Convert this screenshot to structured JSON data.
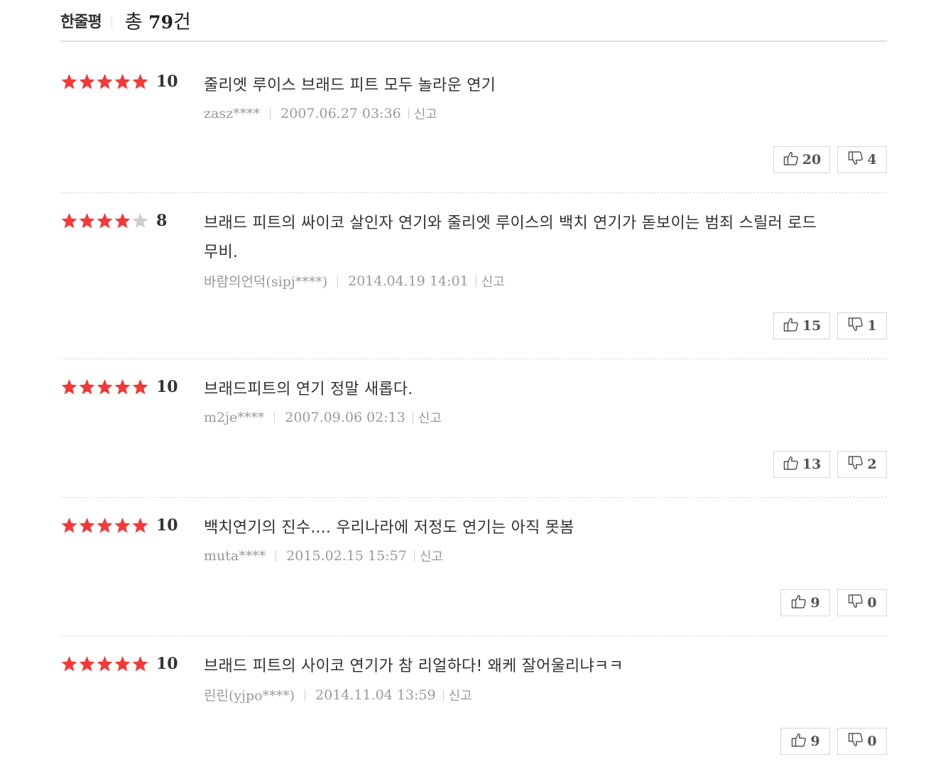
{
  "header": {
    "title": "한줄평",
    "total_prefix": "총",
    "total_count": "79",
    "total_suffix": "건"
  },
  "colors": {
    "star_on": "#f03a3a",
    "star_off": "#cfcfcf"
  },
  "reviews": [
    {
      "stars": 5,
      "score": "10",
      "text_lines": [
        "줄리엣 루이스 브래드 피트 모두 놀라운 연기"
      ],
      "author": "zasz****",
      "date": "2007.06.27 03:36",
      "report": "신고",
      "up": "20",
      "down": "4"
    },
    {
      "stars": 4,
      "score": "8",
      "text_lines": [
        "브래드 피트의 싸이코 살인자 연기와 줄리엣 루이스의 백치 연기가 돋보이는 범죄 스릴러 로드",
        "무비."
      ],
      "author": "바람의언덕(sipj****)",
      "date": "2014.04.19 14:01",
      "report": "신고",
      "up": "15",
      "down": "1"
    },
    {
      "stars": 5,
      "score": "10",
      "text_lines": [
        "브래드피트의 연기 정말 새롭다."
      ],
      "author": "m2je****",
      "date": "2007.09.06 02:13",
      "report": "신고",
      "up": "13",
      "down": "2"
    },
    {
      "stars": 5,
      "score": "10",
      "text_lines": [
        "백치연기의 진수.... 우리나라에 저정도 연기는 아직 못봄"
      ],
      "author": "muta****",
      "date": "2015.02.15 15:57",
      "report": "신고",
      "up": "9",
      "down": "0"
    },
    {
      "stars": 5,
      "score": "10",
      "text_lines": [
        "브래드 피트의 사이코 연기가 참 리얼하다! 왜케 잘어울리냐ㅋㅋ"
      ],
      "author": "린린(yjpo****)",
      "date": "2014.11.04 13:59",
      "report": "신고",
      "up": "9",
      "down": "0"
    }
  ]
}
